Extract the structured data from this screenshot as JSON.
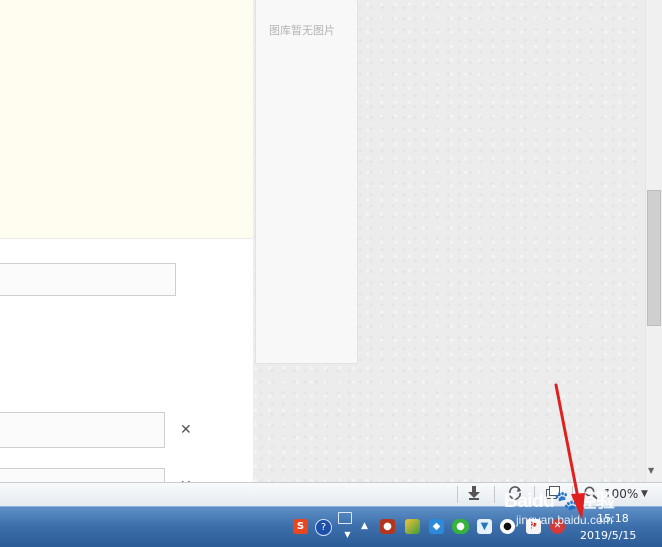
{
  "gallery": {
    "empty_text": "图库暂无图片"
  },
  "form": {
    "clear_symbol": "✕"
  },
  "statusbar": {
    "zoom_label": "100%",
    "icons": [
      "download-icon",
      "sync-icon",
      "window-icon",
      "zoom-icon"
    ]
  },
  "taskbar": {
    "clock_time": "15:18",
    "clock_date": "2019/5/15",
    "tray_icons": [
      "sogou-input-icon",
      "help-icon",
      "network-icon",
      "show-hidden-icons-icon",
      "app-red-icon",
      "app-green-icon",
      "box-icon",
      "wechat-icon",
      "security-shield-icon",
      "qq-icon",
      "flag-icon",
      "stop-icon"
    ]
  },
  "watermark": {
    "logo_text": "Baidu",
    "logo_suffix": "经验",
    "url": "jingyan.baidu.com"
  },
  "colors": {
    "annotation_red": "#e02020",
    "taskbar_blue": "#3b6eaa",
    "notice_bg": "#fffdf0"
  }
}
